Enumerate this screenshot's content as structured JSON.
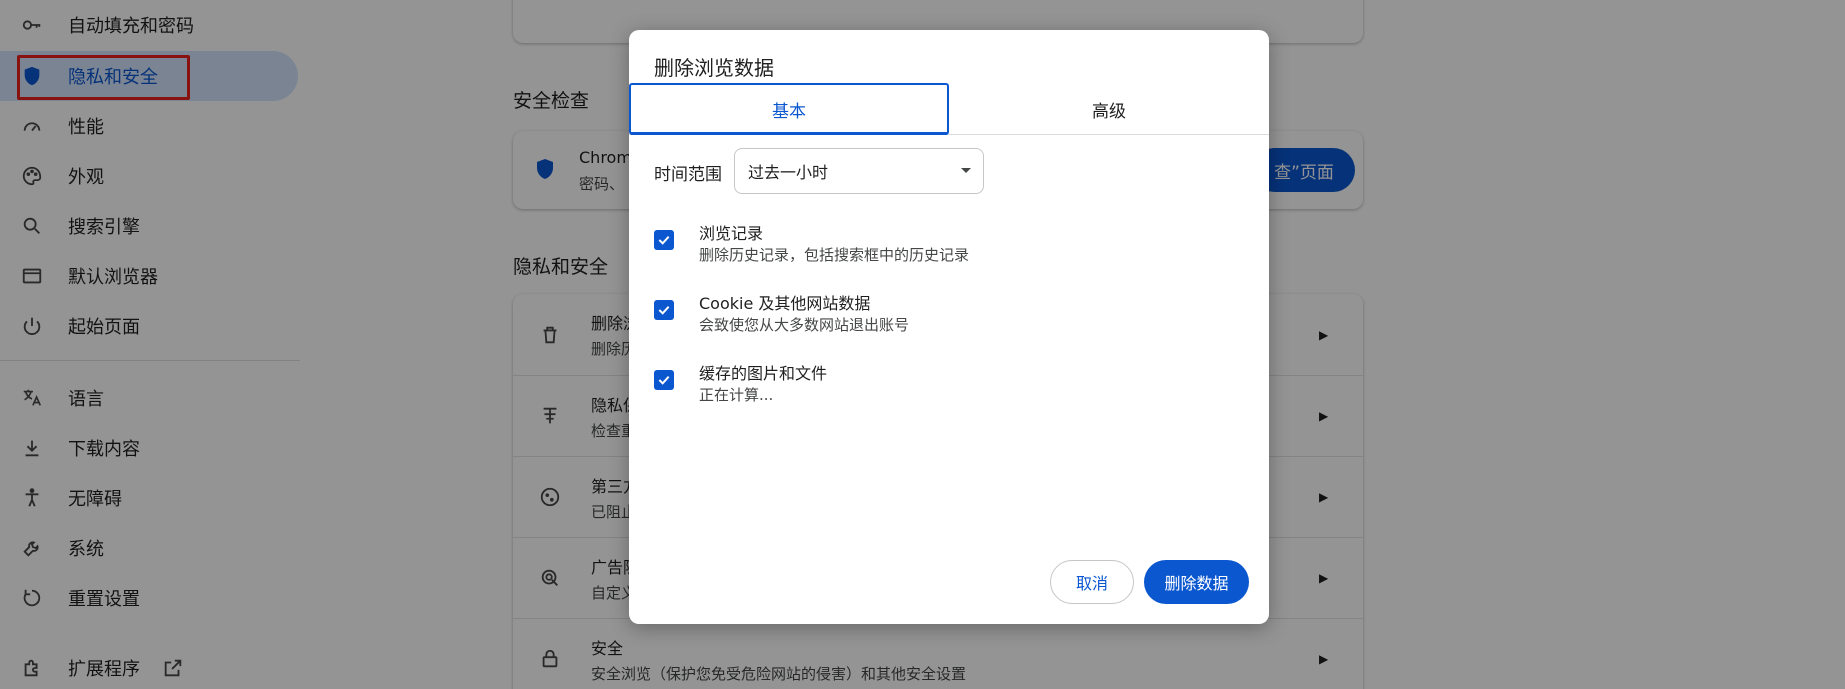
{
  "sidebar": {
    "items": [
      {
        "label": "自动填充和密码",
        "icon": "key-icon"
      },
      {
        "label": "隐私和安全",
        "icon": "shield-icon"
      },
      {
        "label": "性能",
        "icon": "speedometer-icon"
      },
      {
        "label": "外观",
        "icon": "palette-icon"
      },
      {
        "label": "搜索引擎",
        "icon": "search-icon"
      },
      {
        "label": "默认浏览器",
        "icon": "browser-window-icon"
      },
      {
        "label": "起始页面",
        "icon": "power-icon"
      },
      {
        "label": "语言",
        "icon": "translate-icon"
      },
      {
        "label": "下载内容",
        "icon": "download-icon"
      },
      {
        "label": "无障碍",
        "icon": "accessibility-icon"
      },
      {
        "label": "系统",
        "icon": "wrench-icon"
      },
      {
        "label": "重置设置",
        "icon": "reset-icon"
      },
      {
        "label": "扩展程序",
        "icon": "puzzle-icon"
      }
    ]
  },
  "main": {
    "safety_check_title": "安全检查",
    "safety_card": {
      "title": "Chrom",
      "subtitle": "密码、",
      "button": "查”页面"
    },
    "privacy_title": "隐私和安全",
    "rows": [
      {
        "title": "删除浏",
        "subtitle": "删除历",
        "icon": "trash-icon"
      },
      {
        "title": "隐私保",
        "subtitle": "检查重",
        "icon": "privacy-guide-icon"
      },
      {
        "title": "第三方",
        "subtitle": "已阻止",
        "icon": "cookie-icon"
      },
      {
        "title": "广告隐",
        "subtitle": "自定义",
        "icon": "ad-privacy-icon"
      },
      {
        "title": "安全",
        "subtitle": "安全浏览（保护您免受危险网站的侵害）和其他安全设置",
        "icon": "lock-icon"
      }
    ]
  },
  "dialog": {
    "title": "删除浏览数据",
    "tabs": [
      {
        "label": "基本",
        "selected": true
      },
      {
        "label": "高级",
        "selected": false
      }
    ],
    "time_range_label": "时间范围",
    "time_range_value": "过去一小时",
    "options": [
      {
        "title": "浏览记录",
        "subtitle": "删除历史记录，包括搜索框中的历史记录",
        "checked": true
      },
      {
        "title": "Cookie 及其他网站数据",
        "subtitle": "会致使您从大多数网站退出账号",
        "checked": true
      },
      {
        "title": "缓存的图片和文件",
        "subtitle": "正在计算...",
        "checked": true
      }
    ],
    "cancel_label": "取消",
    "delete_label": "删除数据"
  },
  "colors": {
    "accent": "#0b57d0",
    "highlight": "#e8201a"
  }
}
